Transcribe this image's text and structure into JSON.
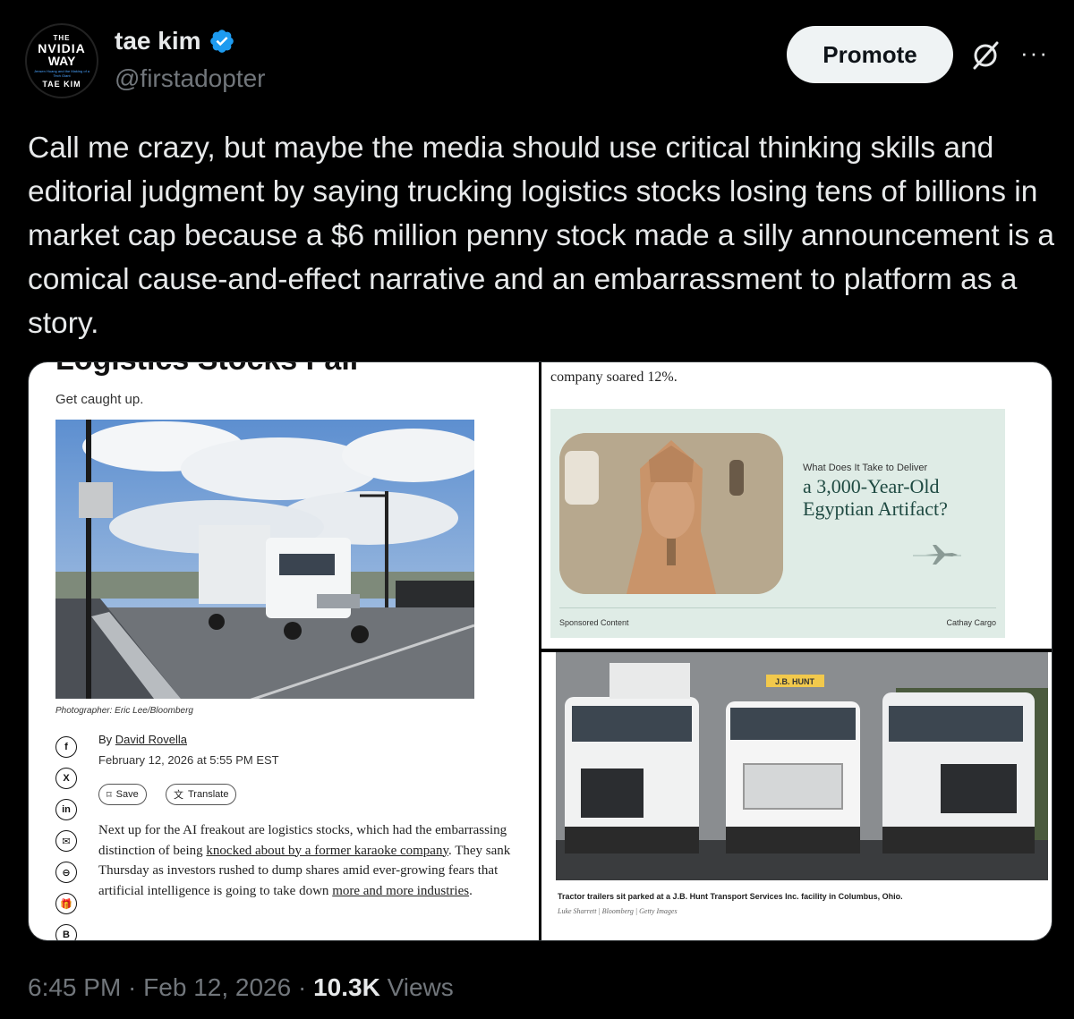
{
  "author": {
    "avatar_text": {
      "top": "THE",
      "mid1": "NVIDIA",
      "mid2": "WAY",
      "tagline": "Jensen Huang and the Making of a Tech Giant",
      "bottom": "TAE KIM"
    },
    "display_name": "tae kim",
    "handle": "@firstadopter",
    "verified": true
  },
  "header": {
    "promote_label": "Promote",
    "grok_icon": "grok-icon",
    "more_icon": "···"
  },
  "tweet": {
    "text": "Call me crazy, but maybe the media should use critical thinking skills and editorial judgment by saying trucking logistics stocks losing tens of billions in market cap because a $6 million penny stock made a silly announcement is a comical cause-and-effect narrative and an embarrassment to platform as a story."
  },
  "media": {
    "left": {
      "title": "Logistics Stocks Fall",
      "subtitle": "Get caught up.",
      "photo_credit": "Photographer: Eric Lee/Bloomberg",
      "byline_prefix": "By ",
      "author": "David Rovella",
      "date": "February 12, 2026 at 5:55 PM EST",
      "save_label": "Save",
      "translate_label": "Translate",
      "share_icons": [
        "f",
        "X",
        "in",
        "✉",
        "⊖",
        "🎁",
        "B"
      ],
      "body_1": "Next up for the AI freakout are logistics stocks, which had the embarrassing distinction of being ",
      "body_link1": "knocked about by a former karaoke company",
      "body_2": ". They sank Thursday as investors rushed to dump shares amid ever-growing fears that artificial intelligence is going to take down ",
      "body_link2": "more and more industries",
      "body_3": "."
    },
    "right_top": {
      "text": "company soared 12%.",
      "ad_small": "What Does It Take to Deliver",
      "ad_big": "a 3,000-Year-Old Egyptian Artifact?",
      "sponsored": "Sponsored Content",
      "brand": "Cathay Cargo"
    },
    "right_bottom": {
      "caption": "Tractor trailers sit parked at a J.B. Hunt Transport Services Inc. facility in Columbus, Ohio.",
      "credit": "Luke Sharrett | Bloomberg | Getty Images",
      "truck_sign": "J.B. HUNT"
    }
  },
  "meta": {
    "time": "6:45 PM",
    "sep": " · ",
    "date": "Feb 12, 2026",
    "views_count": "10.3K",
    "views_label": " Views"
  },
  "colors": {
    "background": "#000000",
    "text": "#e7e9ea",
    "muted": "#71767b",
    "verified": "#1d9bf0"
  }
}
